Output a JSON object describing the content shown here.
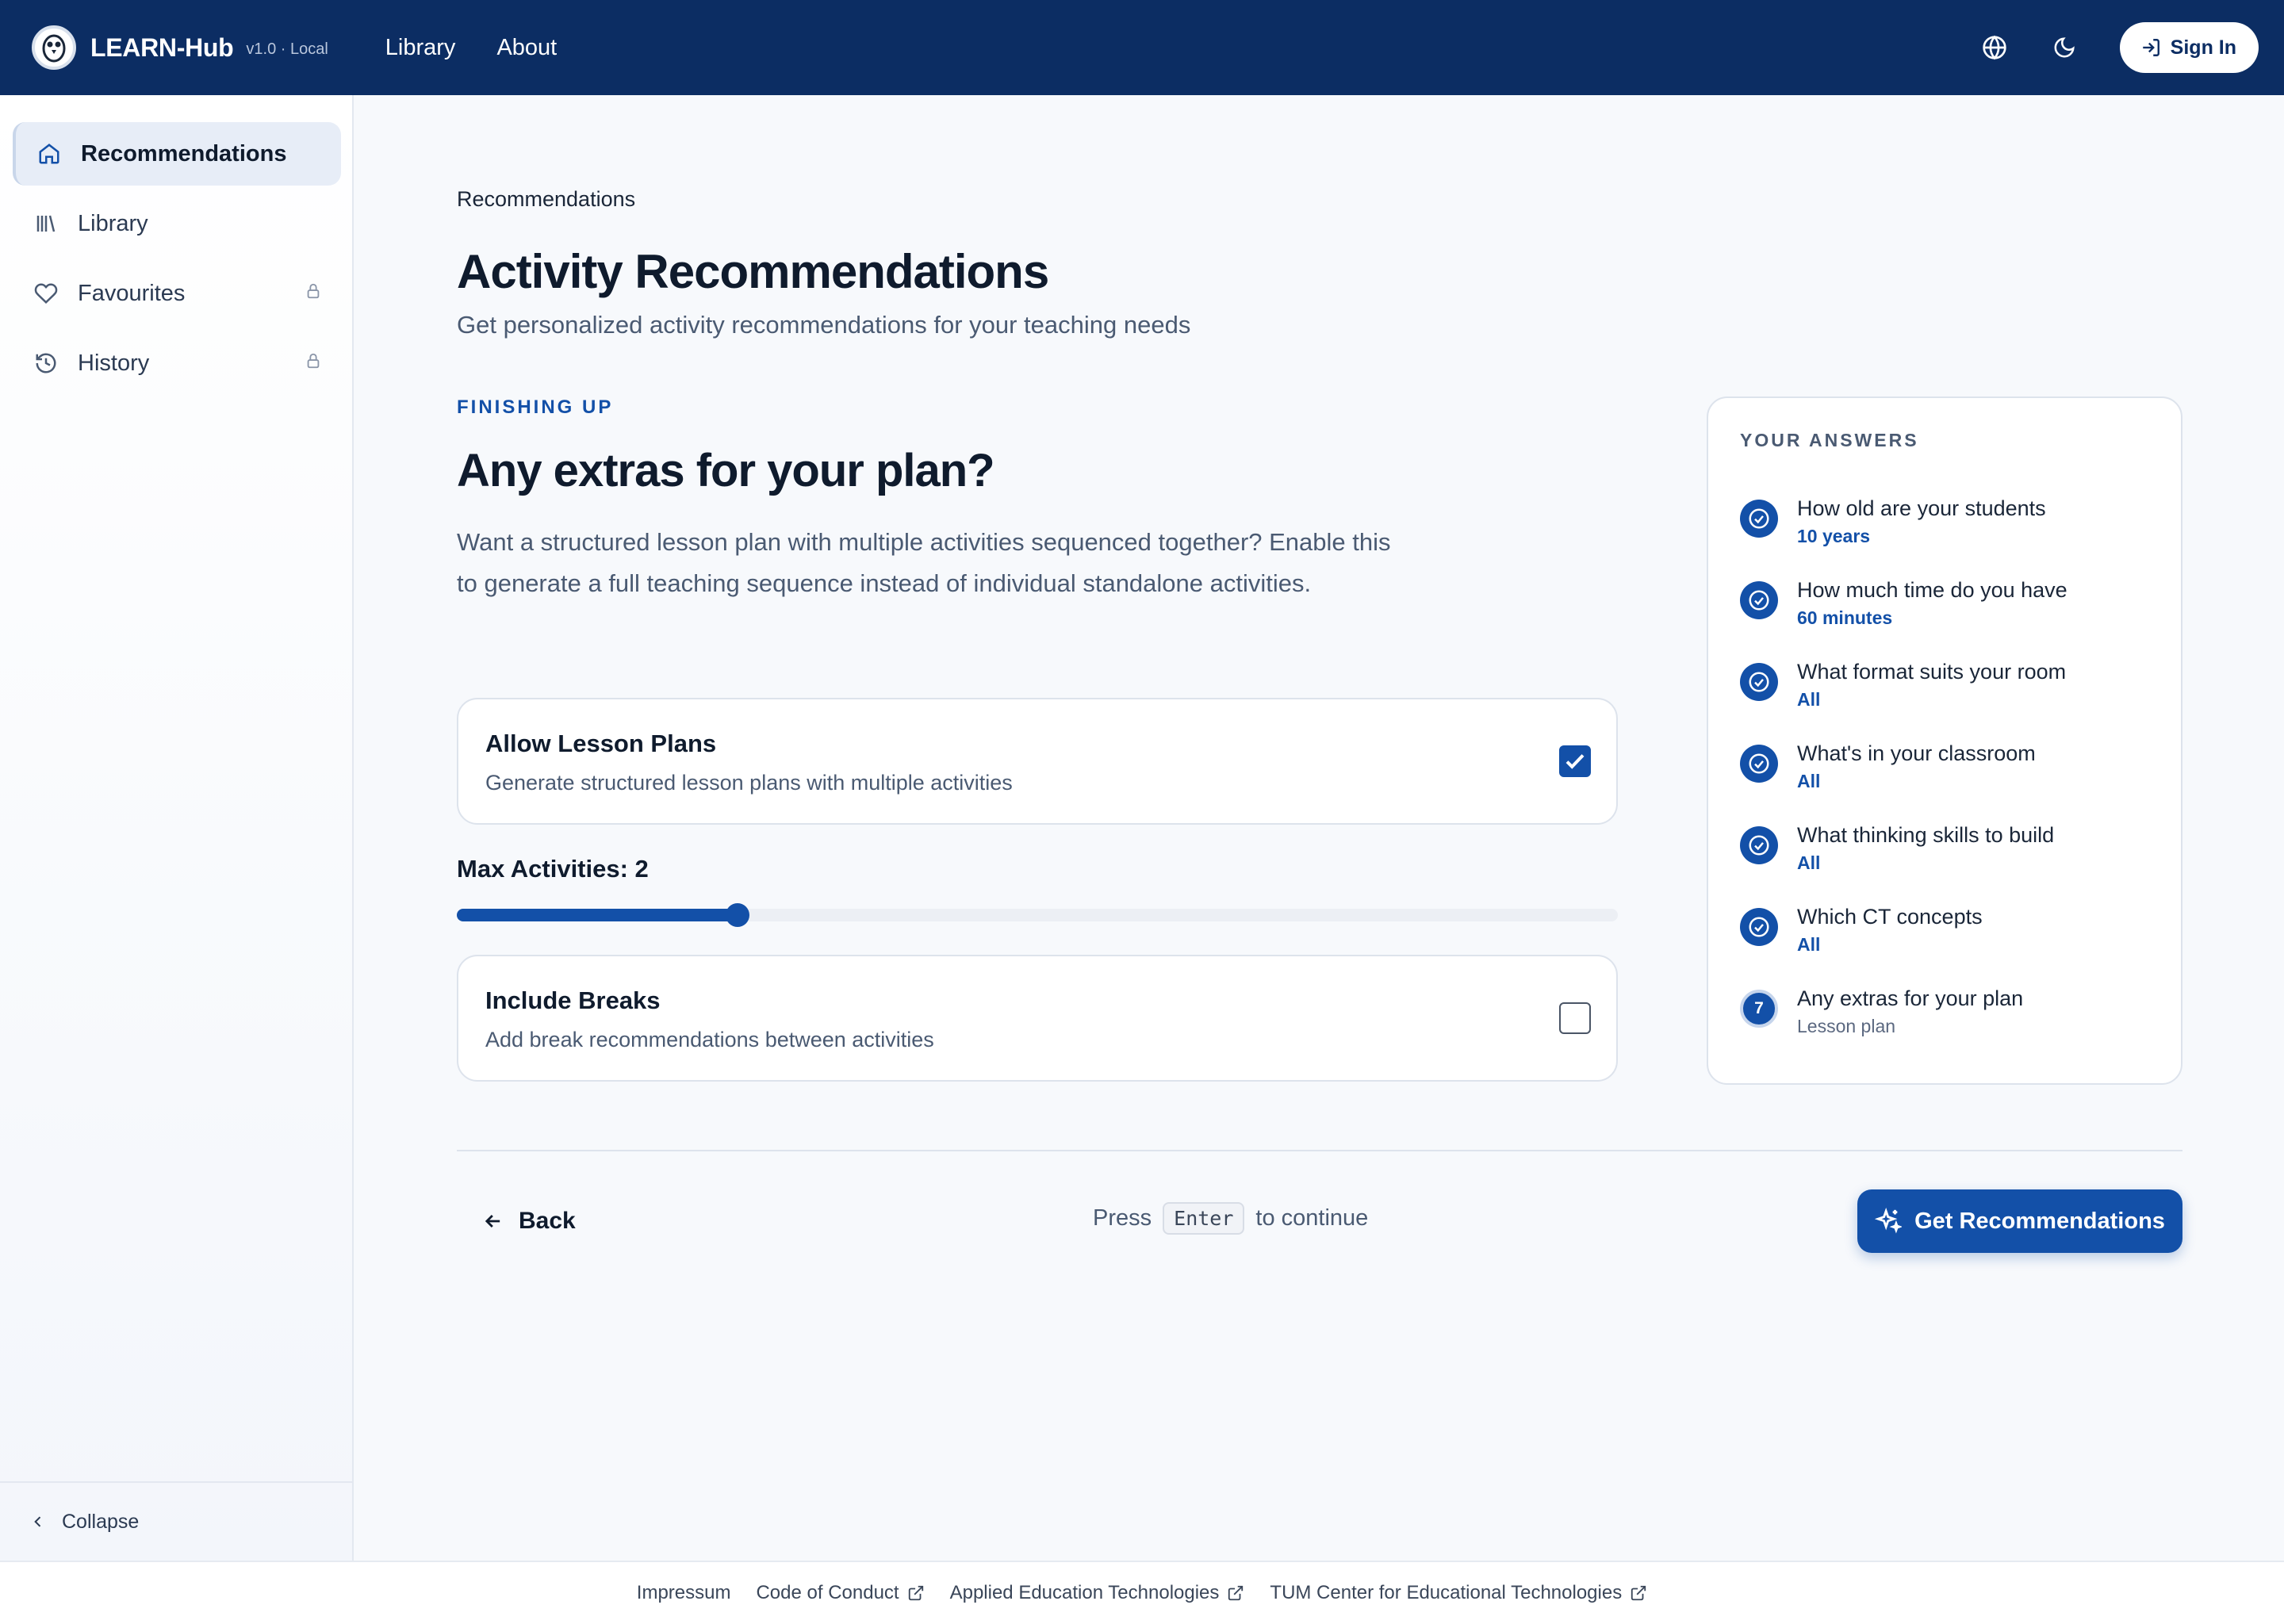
{
  "header": {
    "brand": "LEARN-Hub",
    "version": "v1.0 · Local",
    "nav": [
      "Library",
      "About"
    ],
    "signin_label": "Sign In"
  },
  "sidebar": {
    "items": [
      {
        "label": "Recommendations",
        "icon": "home-icon",
        "active": true,
        "locked": false
      },
      {
        "label": "Library",
        "icon": "library-icon",
        "active": false,
        "locked": false
      },
      {
        "label": "Favourites",
        "icon": "heart-icon",
        "active": false,
        "locked": true
      },
      {
        "label": "History",
        "icon": "history-icon",
        "active": false,
        "locked": true
      }
    ],
    "collapse_label": "Collapse"
  },
  "main": {
    "breadcrumb": "Recommendations",
    "title": "Activity Recommendations",
    "subtitle": "Get personalized activity recommendations for your teaching needs",
    "step_label": "FINISHING UP",
    "question": "Any extras for your plan?",
    "description": "Want a structured lesson plan with multiple activities sequenced together? Enable this to generate a full teaching sequence instead of individual standalone activities.",
    "options": [
      {
        "title": "Allow Lesson Plans",
        "desc": "Generate structured lesson plans with multiple activities",
        "checked": true
      },
      {
        "title": "Include Breaks",
        "desc": "Add break recommendations between activities",
        "checked": false
      }
    ],
    "slider": {
      "label": "Max Activities: 2",
      "value": 2,
      "min": 1,
      "max": 8
    },
    "back_label": "Back",
    "press_label": "Press",
    "kbd": "Enter",
    "continue_label": "to continue",
    "cta_label": "Get Recommendations"
  },
  "answers": {
    "title": "YOUR ANSWERS",
    "items": [
      {
        "q": "How old are your students",
        "v": "10 years",
        "done": true
      },
      {
        "q": "How much time do you have",
        "v": "60 minutes",
        "done": true
      },
      {
        "q": "What format suits your room",
        "v": "All",
        "done": true
      },
      {
        "q": "What's in your classroom",
        "v": "All",
        "done": true
      },
      {
        "q": "What thinking skills to build",
        "v": "All",
        "done": true
      },
      {
        "q": "Which CT concepts",
        "v": "All",
        "done": true
      },
      {
        "q": "Any extras for your plan",
        "v": "Lesson plan",
        "done": false,
        "step": "7"
      }
    ]
  },
  "footer": {
    "links": [
      "Impressum",
      "Code of Conduct",
      "Applied Education Technologies",
      "TUM Center for Educational Technologies"
    ]
  },
  "colors": {
    "primary": "#1350a8",
    "header": "#0c2d63"
  }
}
